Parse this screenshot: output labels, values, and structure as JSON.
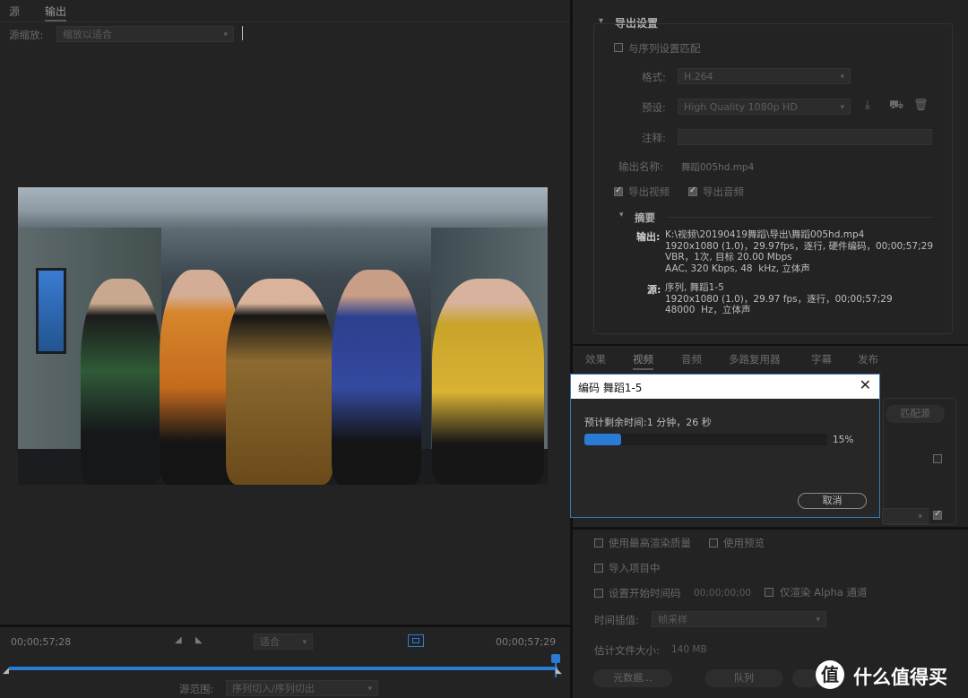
{
  "left_panel": {
    "tabs": [
      {
        "label": "源",
        "active": false
      },
      {
        "label": "输出",
        "active": true
      }
    ],
    "source_scaling": {
      "label": "源缩放:",
      "value": "缩放以适合"
    },
    "timecode_left": "00;00;57;28",
    "timecode_right": "00;00;57;29",
    "zoom": "适合",
    "source_range": {
      "label": "源范围:",
      "value": "序列切入/序列切出"
    }
  },
  "export_settings": {
    "title": "导出设置",
    "match_sequence": "与序列设置匹配",
    "format": {
      "label": "格式:",
      "value": "H.264"
    },
    "preset": {
      "label": "预设:",
      "value": "High Quality 1080p HD"
    },
    "comments": {
      "label": "注释:",
      "value": ""
    },
    "output_name": {
      "label": "输出名称:",
      "value": "舞蹈005hd.mp4"
    },
    "export_video": "导出视频",
    "export_audio": "导出音频",
    "summary": {
      "title": "摘要",
      "output_key": "输出:",
      "output_lines": "K:\\视频\\20190419舞蹈\\导出\\舞蹈005hd.mp4\n1920x1080 (1.0)，29.97fps，逐行, 硬件编码，00;00;57;29\nVBR，1次, 目标 20.00 Mbps\nAAC, 320 Kbps, 48  kHz, 立体声",
      "source_key": "源:",
      "source_lines": "序列, 舞蹈1-5\n1920x1080 (1.0)，29.97 fps，逐行，00;00;57;29\n48000  Hz，立体声"
    }
  },
  "tabs_bottom": [
    {
      "label": "效果",
      "active": false
    },
    {
      "label": "视频",
      "active": true
    },
    {
      "label": "音频",
      "active": false
    },
    {
      "label": "多路复用器",
      "active": false
    },
    {
      "label": "字幕",
      "active": false
    },
    {
      "label": "发布",
      "active": false
    }
  ],
  "match_source_button": "匹配源",
  "options": {
    "max_render": "使用最高渲染质量",
    "use_previews": "使用预览",
    "import_project": "导入项目中",
    "set_start_tc": "设置开始时间码",
    "start_tc_value": "00;00;00;00",
    "render_alpha": "仅渲染 Alpha 通道",
    "interpolation": {
      "label": "时间插值:",
      "value": "帧采样"
    },
    "file_size": {
      "label": "估计文件大小:",
      "value": "140 MB"
    }
  },
  "footer_buttons": {
    "metadata": "元数据...",
    "queue": "队列"
  },
  "modal": {
    "title": "编码 舞蹈1-5",
    "eta": "预计剩余时间:1 分钟，26 秒",
    "progress": 0.15,
    "progress_text": "15%",
    "cancel": "取消"
  },
  "watermark": {
    "text": "什么值得买"
  },
  "colors": {
    "accent": "#2a7bd4",
    "background": "#232323"
  }
}
